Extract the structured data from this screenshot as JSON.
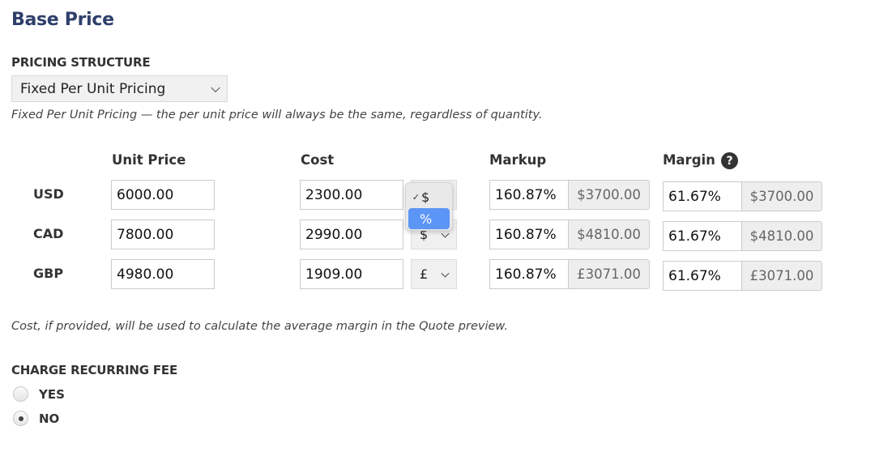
{
  "title": "Base Price",
  "pricing_structure": {
    "label": "PRICING STRUCTURE",
    "selected": "Fixed Per Unit Pricing",
    "description": "Fixed Per Unit Pricing — the per unit price will always be the same, regardless of quantity."
  },
  "table": {
    "headers": {
      "unit_price": "Unit Price",
      "cost": "Cost",
      "markup": "Markup",
      "margin": "Margin"
    },
    "help_icon": "?",
    "rows": [
      {
        "currency": "USD",
        "unit_price": "6000.00",
        "cost": "2300.00",
        "cost_type": "$",
        "markup_pct": "160.87%",
        "markup_amt": "$3700.00",
        "margin_pct": "61.67%",
        "margin_amt": "$3700.00"
      },
      {
        "currency": "CAD",
        "unit_price": "7800.00",
        "cost": "2990.00",
        "cost_type": "$",
        "markup_pct": "160.87%",
        "markup_amt": "$4810.00",
        "margin_pct": "61.67%",
        "margin_amt": "$4810.00"
      },
      {
        "currency": "GBP",
        "unit_price": "4980.00",
        "cost": "1909.00",
        "cost_type": "£",
        "markup_pct": "160.87%",
        "markup_amt": "£3071.00",
        "margin_pct": "61.67%",
        "margin_amt": "£3071.00"
      }
    ]
  },
  "cost_type_dropdown": {
    "options": [
      {
        "label": "$",
        "checked": true,
        "highlighted": false
      },
      {
        "label": "%",
        "checked": false,
        "highlighted": true
      }
    ],
    "check_glyph": "✓"
  },
  "cost_note": "Cost, if provided, will be used to calculate the average margin in the Quote preview.",
  "recurring_fee": {
    "label": "CHARGE RECURRING FEE",
    "options": [
      {
        "label": "YES",
        "checked": false
      },
      {
        "label": "NO",
        "checked": true
      }
    ]
  }
}
